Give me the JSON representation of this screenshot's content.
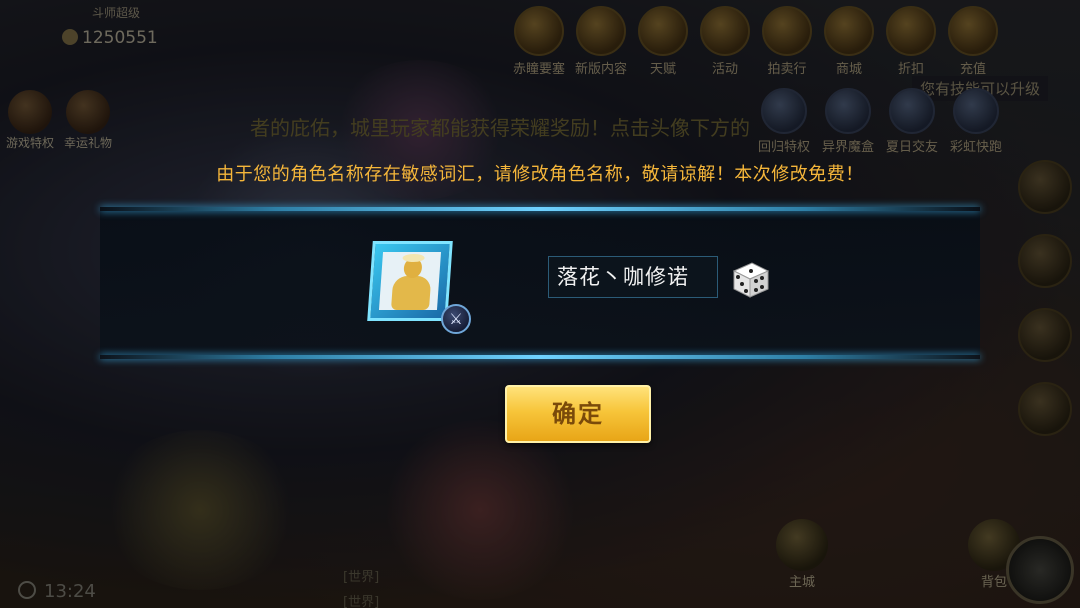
{
  "background": {
    "player_title": "斗师超级",
    "coins": "1250551",
    "top_icons": [
      "赤瞳要塞",
      "新版内容",
      "天赋",
      "活动",
      "拍卖行",
      "商城",
      "折扣",
      "充值"
    ],
    "second_row_icons": [
      "回归特权",
      "异界魔盒",
      "夏日交友",
      "彩虹快跑"
    ],
    "left_icons": [
      "游戏特权",
      "幸运礼物"
    ],
    "banner_text": "者的庇佑，城里玩家都能获得荣耀奖励！点击头像下方的",
    "skill_tip": "您有技能可以升级",
    "time": "13:24",
    "bottom_buttons": [
      "主城",
      "背包"
    ],
    "chat_lines": [
      "[世界]",
      "[世界]"
    ]
  },
  "dialog": {
    "notice": "由于您的角色名称存在敏感词汇，请修改角色名称，敬请谅解！本次修改免费！",
    "name_value": "落花丶咖修诺",
    "confirm_label": "确定"
  },
  "colors": {
    "notice": "#f5b63a",
    "panel_edge": "#6fd2ff",
    "confirm_top": "#ffe27a",
    "confirm_bottom": "#e8a517"
  },
  "icons": [
    "portrait-avatar",
    "sword-badge-icon",
    "dice-icon"
  ]
}
